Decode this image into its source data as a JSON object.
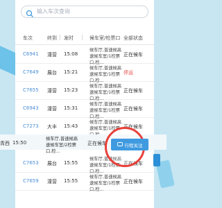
{
  "search": {
    "placeholder": "输入车次查询"
  },
  "table": {
    "headers": {
      "train": "车次",
      "from": "终到",
      "time": "发时",
      "gate": "候车室/检票口",
      "status": "全部状态"
    },
    "rows": [
      {
        "train": "C6941",
        "from": "潼营",
        "time": "15:08",
        "gate": "候车厅,普速候高速候车室/1检票口,检...",
        "status": "正在候车",
        "late": false
      },
      {
        "train": "C7649",
        "from": "展台",
        "time": "15:21",
        "gate": "候车厅,普速候高速候车室/1检票口,检...",
        "status": "停运",
        "late": true
      },
      {
        "train": "C7655",
        "from": "潼营",
        "time": "15:23",
        "gate": "候车厅,普速候高速候车室/1检票口,检...",
        "status": "正在候车",
        "late": false
      },
      {
        "train": "C6943",
        "from": "潼营",
        "time": "15:31",
        "gate": "候车厅,普速候高速候车室/1检票口,检...",
        "status": "正在候车",
        "late": false
      },
      {
        "train": "C7273",
        "from": "大丰",
        "time": "15:43",
        "gate": "候车厅,普速候高速候车室/1检票口,检...",
        "status": "正在候车",
        "late": false
      },
      {
        "train": "C7653",
        "from": "展台",
        "time": "15:55",
        "gate": "候车厅,普速候高速候车室/1检票口,检...",
        "status": "正在候车",
        "late": false
      },
      {
        "train": "C7659",
        "from": "潼营",
        "time": "15:55",
        "gate": "候车厅,普速候高速候车室/1检票口,检...",
        "status": "正在候车",
        "late": false
      }
    ]
  },
  "overlay_row": {
    "from": "青西",
    "time": "15:50",
    "gate": "候车厅,普速候高速候车室/2检票口,检...",
    "status": "正在候车"
  },
  "follow_button": {
    "label": "行程关注"
  },
  "colors": {
    "accent": "#3f9ae0",
    "highlight": "#e8403a",
    "train_text": "#4a8fd8",
    "late": "#e54d42"
  }
}
